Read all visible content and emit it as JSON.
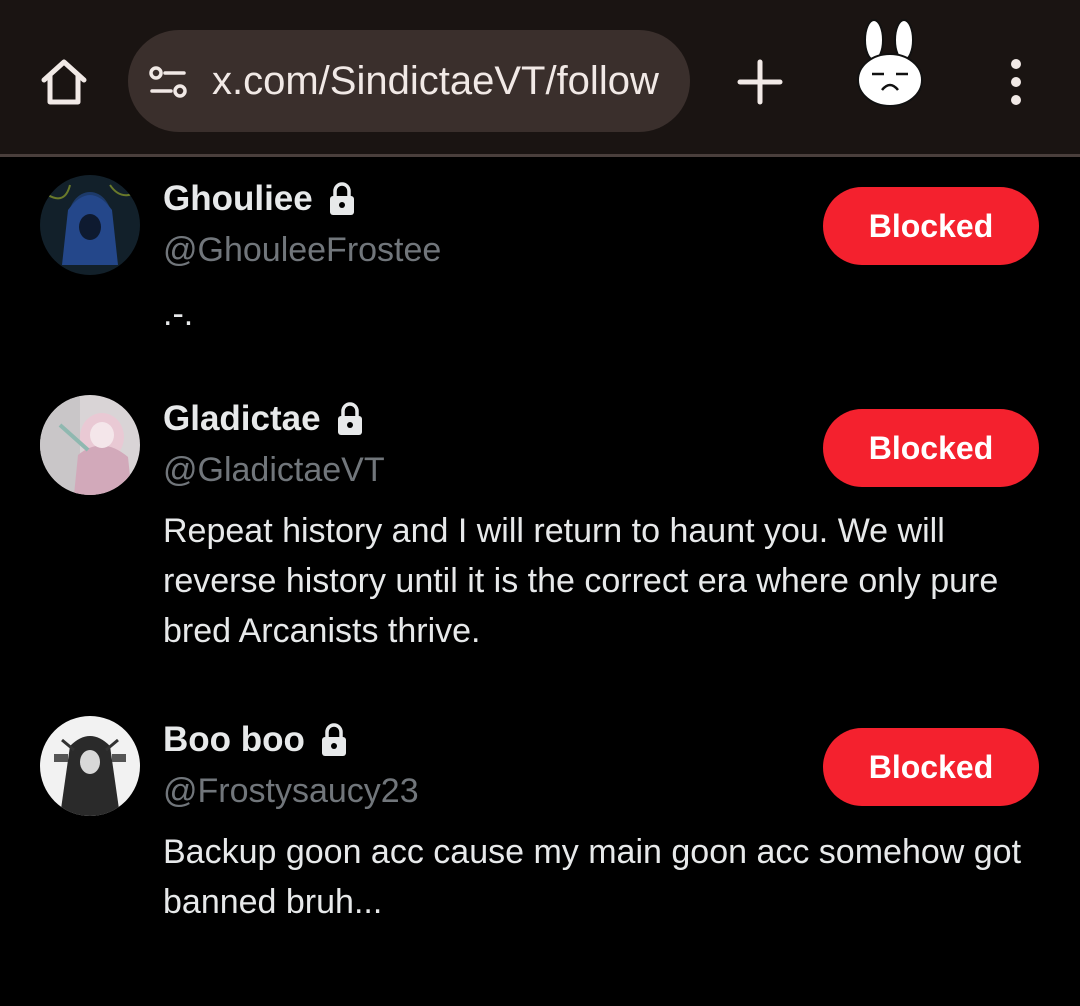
{
  "browser": {
    "url": "x.com/SindictaeVT/follow"
  },
  "accounts": [
    {
      "display_name": "Ghouliee",
      "handle": "@GhouleeFrostee",
      "bio": ".-.",
      "button_label": "Blocked",
      "protected": true
    },
    {
      "display_name": "Gladictae",
      "handle": "@GladictaeVT",
      "bio": "Repeat history and I will return to haunt you. We will reverse history until it is the correct era where only pure bred Arcanists thrive.",
      "button_label": "Blocked",
      "protected": true
    },
    {
      "display_name": "Boo boo",
      "handle": "@Frostysaucy23",
      "bio": "Backup goon acc cause my main goon acc somehow got banned bruh...",
      "button_label": "Blocked",
      "protected": true
    }
  ],
  "colors": {
    "accent_blocked": "#f4212e",
    "handle_gray": "#71767b",
    "topbar": "#1a1412"
  }
}
